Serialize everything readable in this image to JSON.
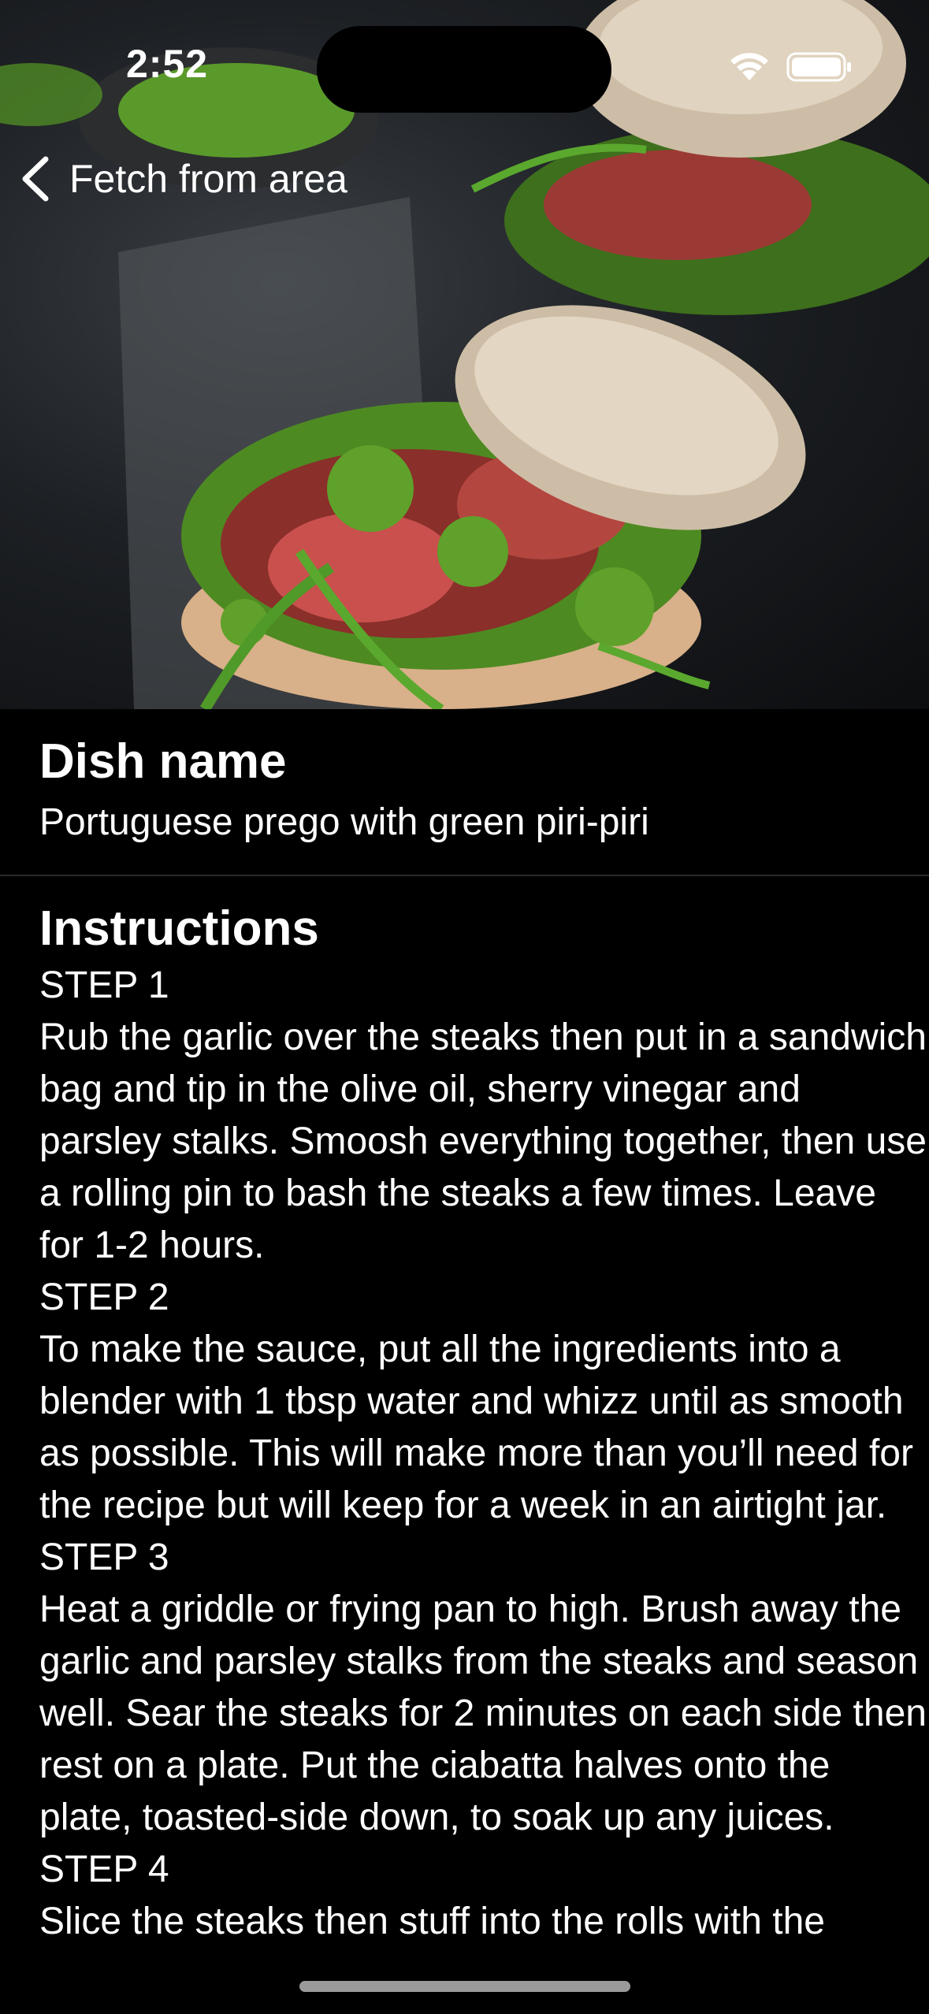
{
  "status_bar": {
    "time": "2:52"
  },
  "nav": {
    "back_label": "Fetch from area"
  },
  "hero": {
    "image": "steak-sandwich-photo"
  },
  "dish": {
    "heading": "Dish name",
    "name": "Portuguese prego with green piri-piri"
  },
  "instructions": {
    "heading": "Instructions",
    "text": "STEP 1\nRub the garlic over the steaks then put in a sandwich bag and tip in the olive oil, sherry vinegar and parsley stalks. Smoosh everything together, then use a rolling pin to bash the steaks a few times. Leave for 1-2 hours.\nSTEP 2\nTo make the sauce, put all the ingredients into a blender with 1 tbsp water and whizz until as smooth as possible. This will make more than you’ll need for the recipe but will keep for a week in an airtight jar.\nSTEP 3\nHeat a griddle or frying pan to high. Brush away the garlic and parsley stalks from the steaks and season well. Sear the steaks for 2 minutes on each side then rest on a plate. Put the ciabatta halves onto the plate, toasted-side down, to soak up any juices.\nSTEP 4\nSlice the steaks then stuff into the rolls with the"
  },
  "colors": {
    "background": "#000000",
    "text": "#ffffff",
    "divider": "#2a2a2c"
  }
}
